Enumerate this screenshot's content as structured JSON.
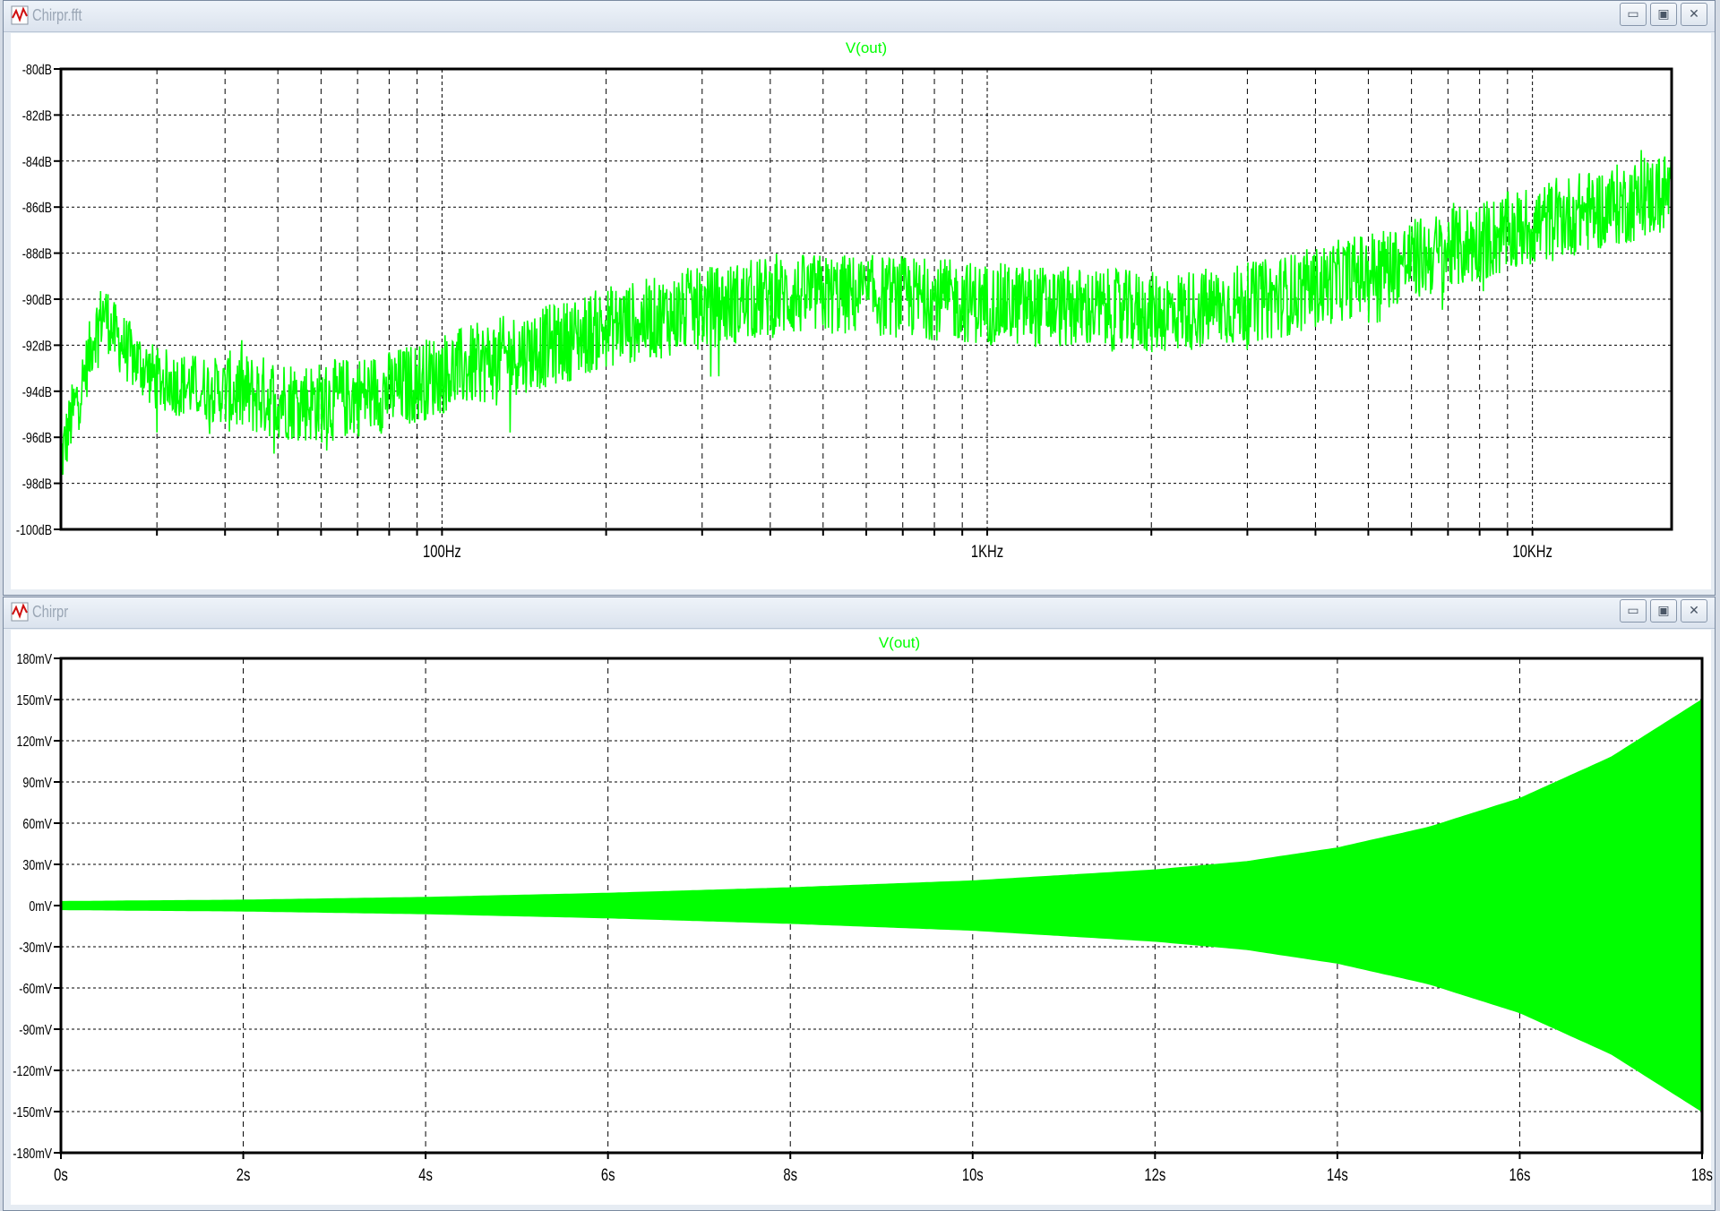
{
  "colors": {
    "trace": "#00ff00",
    "grid": "#000000",
    "background": "#ffffff",
    "title_text": "#9aa6b5"
  },
  "windows": [
    {
      "title": "Chirpr.fft",
      "icon": "waveform-icon",
      "controls": {
        "minimize": "minimize-icon",
        "maximize": "maximize-icon",
        "close": "close-icon"
      }
    },
    {
      "title": "Chirpr",
      "icon": "waveform-icon",
      "controls": {
        "minimize": "minimize-icon",
        "maximize": "maximize-icon",
        "close": "close-icon"
      }
    }
  ],
  "chart_data": [
    {
      "type": "line",
      "title": "V(out)",
      "xscale": "log",
      "xlim": [
        20,
        18000
      ],
      "xticks": [
        100,
        1000,
        10000
      ],
      "xtick_labels": [
        "100Hz",
        "1KHz",
        "10KHz"
      ],
      "ylim": [
        -100,
        -80
      ],
      "yticks": [
        -80,
        -82,
        -84,
        -86,
        -88,
        -90,
        -92,
        -94,
        -96,
        -98,
        -100
      ],
      "ytick_labels": [
        "-80dB",
        "-82dB",
        "-84dB",
        "-86dB",
        "-88dB",
        "-90dB",
        "-92dB",
        "-94dB",
        "-96dB",
        "-98dB",
        "-100dB"
      ],
      "grid": true,
      "series": [
        {
          "x": [
            20,
            21,
            22,
            23,
            24,
            25,
            27,
            30,
            35,
            40,
            50,
            60,
            70,
            80,
            100,
            130,
            170,
            200,
            250,
            300,
            400,
            500,
            700,
            1000,
            1500,
            2000,
            2500,
            3000,
            4000,
            5000,
            6000,
            8000,
            10000,
            12000,
            15000,
            18000
          ],
          "y": [
            -97,
            -95,
            -93.5,
            -91.5,
            -90.5,
            -91.5,
            -92.5,
            -93.5,
            -93.8,
            -94,
            -94.3,
            -94.5,
            -94.2,
            -94,
            -93.2,
            -92.5,
            -91.8,
            -91.2,
            -90.8,
            -90.4,
            -89.9,
            -89.8,
            -89.9,
            -90.2,
            -90.4,
            -90.6,
            -90.4,
            -90.2,
            -89.5,
            -88.8,
            -88.3,
            -87.5,
            -86.8,
            -86.3,
            -85.8,
            -85.3
          ],
          "noise_band_db": 1.8
        }
      ]
    },
    {
      "type": "area",
      "title": "V(out)",
      "xlim": [
        0,
        18
      ],
      "xticks": [
        0,
        2,
        4,
        6,
        8,
        10,
        12,
        14,
        16,
        18
      ],
      "xtick_labels": [
        "0s",
        "2s",
        "4s",
        "6s",
        "8s",
        "10s",
        "12s",
        "14s",
        "16s",
        "18s"
      ],
      "ylim": [
        -180,
        180
      ],
      "yticks": [
        180,
        150,
        120,
        90,
        60,
        30,
        0,
        -30,
        -60,
        -90,
        -120,
        -150,
        -180
      ],
      "ytick_labels": [
        "180mV",
        "150mV",
        "120mV",
        "90mV",
        "60mV",
        "30mV",
        "0mV",
        "-30mV",
        "-60mV",
        "-90mV",
        "-120mV",
        "-150mV",
        "-180mV"
      ],
      "grid": true,
      "series": [
        {
          "x": [
            0,
            2,
            4,
            6,
            8,
            10,
            12,
            13,
            14,
            15,
            16,
            17,
            18
          ],
          "upper": [
            3,
            4,
            6,
            9,
            13,
            18,
            26,
            32,
            42,
            57,
            78,
            108,
            150
          ],
          "lower": [
            -3,
            -4,
            -6,
            -9,
            -13,
            -18,
            -26,
            -32,
            -42,
            -57,
            -78,
            -108,
            -150
          ]
        }
      ]
    }
  ]
}
